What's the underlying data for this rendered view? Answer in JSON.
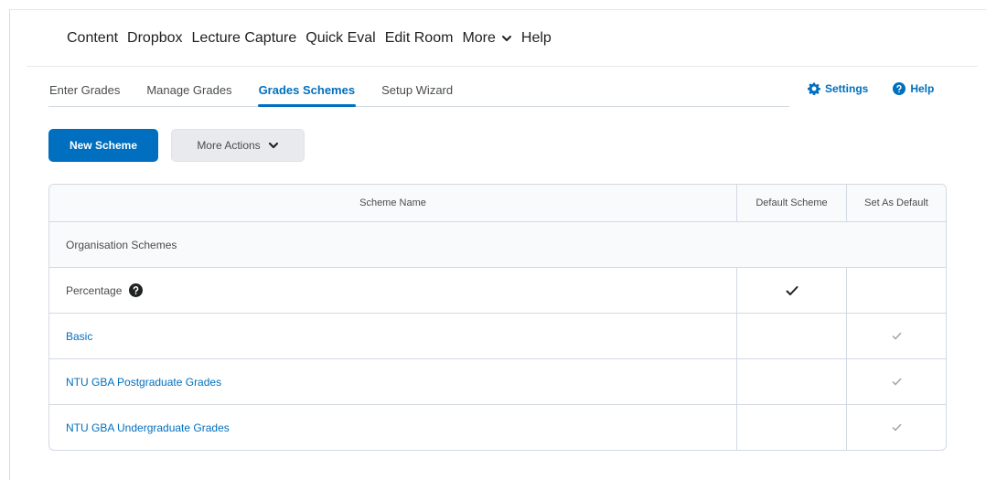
{
  "navbar": {
    "items": [
      {
        "label": "Content"
      },
      {
        "label": "Dropbox"
      },
      {
        "label": "Lecture Capture"
      },
      {
        "label": "Quick Eval"
      },
      {
        "label": "Edit Room"
      },
      {
        "label": "More"
      },
      {
        "label": "Help"
      }
    ]
  },
  "tabs": [
    {
      "label": "Enter Grades"
    },
    {
      "label": "Manage Grades"
    },
    {
      "label": "Grades Schemes"
    },
    {
      "label": "Setup Wizard"
    }
  ],
  "tab_links": {
    "settings": "Settings",
    "help": "Help"
  },
  "actions": {
    "new_scheme": "New Scheme",
    "more_actions": "More Actions"
  },
  "table": {
    "headers": {
      "name": "Scheme Name",
      "default": "Default Scheme",
      "set_default": "Set As Default"
    },
    "group_label": "Organisation Schemes",
    "rows": [
      {
        "name": "Percentage",
        "is_default": true
      },
      {
        "name": "Basic",
        "is_default": false
      },
      {
        "name": "NTU GBA Postgraduate Grades",
        "is_default": false
      },
      {
        "name": "NTU GBA Undergraduate Grades",
        "is_default": false
      }
    ]
  },
  "colors": {
    "accent": "#006fbf",
    "border": "#d3d9e3"
  }
}
